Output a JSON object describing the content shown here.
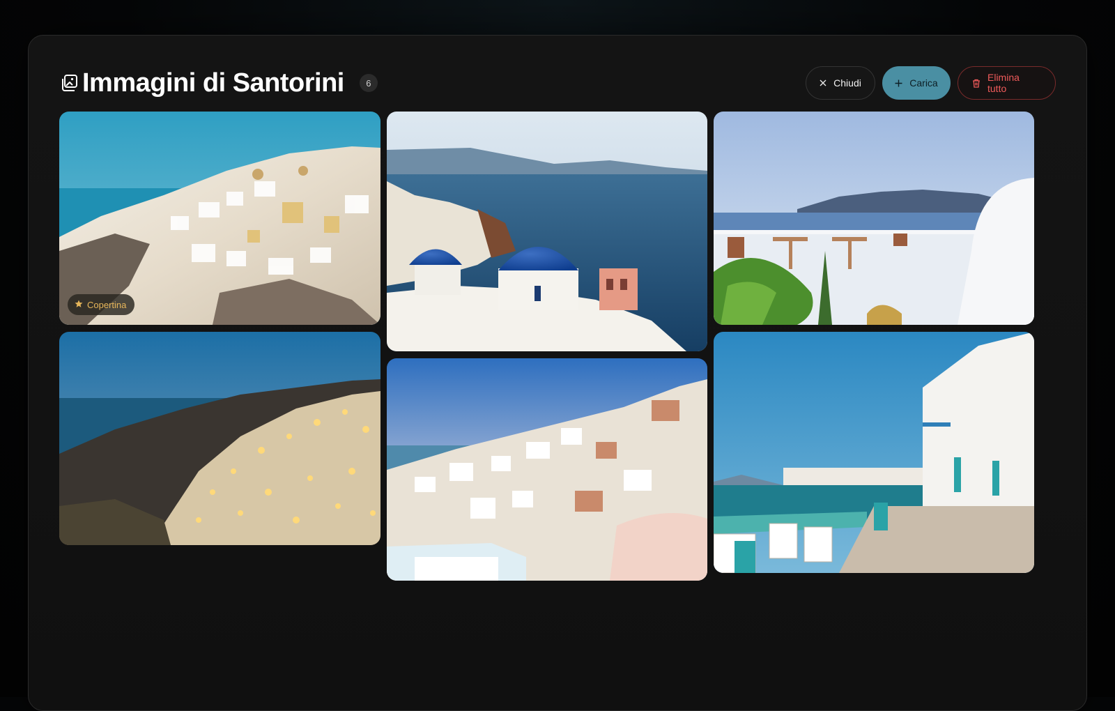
{
  "header": {
    "title": "Immagini di Santorini",
    "count": "6"
  },
  "actions": {
    "close_label": "Chiudi",
    "upload_label": "Carica",
    "delete_label": "Elimina tutto"
  },
  "images": [
    {
      "scene": "oia-village-day",
      "badge": "Copertina"
    },
    {
      "scene": "blue-domes-caldera"
    },
    {
      "scene": "terrace-sea-view"
    },
    {
      "scene": "oia-village-night"
    },
    {
      "scene": "village-sunset"
    },
    {
      "scene": "little-venice-waterfront"
    }
  ],
  "colors": {
    "accent": "#4a8fa3",
    "danger": "#ef5a5a",
    "cover_badge": "#e7b65a"
  }
}
